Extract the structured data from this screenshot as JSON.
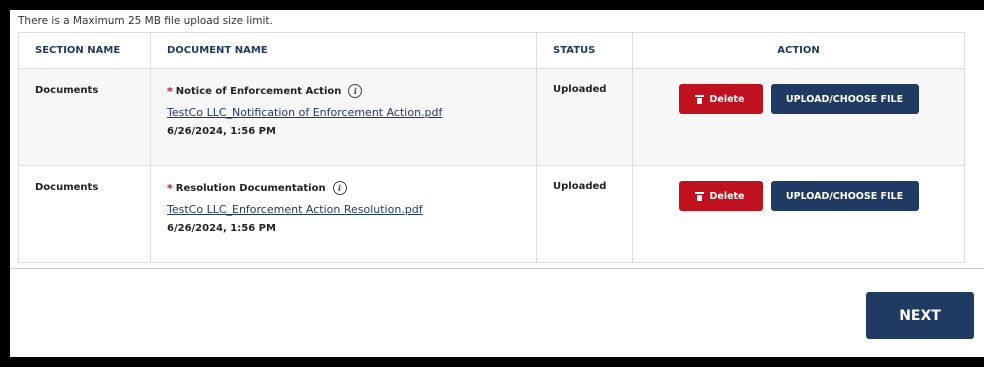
{
  "upload_limit_note": "There is a Maximum 25 MB file upload size limit.",
  "table": {
    "headers": {
      "section": "SECTION NAME",
      "document": "DOCUMENT NAME",
      "status": "STATUS",
      "action": "ACTION"
    },
    "rows": [
      {
        "section": "Documents",
        "required_marker": "*",
        "document_title": "Notice of Enforcement Action",
        "file_name": "TestCo LLC_Notification of Enforcement Action.pdf",
        "date": "6/26/2024, 1:56 PM",
        "status": "Uploaded",
        "delete_label": "Delete",
        "upload_label": "UPLOAD/CHOOSE FILE"
      },
      {
        "section": "Documents",
        "required_marker": "*",
        "document_title": "Resolution Documentation",
        "file_name": "TestCo LLC_Enforcement Action Resolution.pdf",
        "date": "6/26/2024, 1:56 PM",
        "status": "Uploaded",
        "delete_label": "Delete",
        "upload_label": "UPLOAD/CHOOSE FILE"
      }
    ]
  },
  "icons": {
    "info": "info-icon",
    "delete": "trash-icon"
  },
  "next_label": "NEXT",
  "colors": {
    "primary": "#1f3b64",
    "danger": "#c0111f",
    "required": "#c8102e"
  }
}
